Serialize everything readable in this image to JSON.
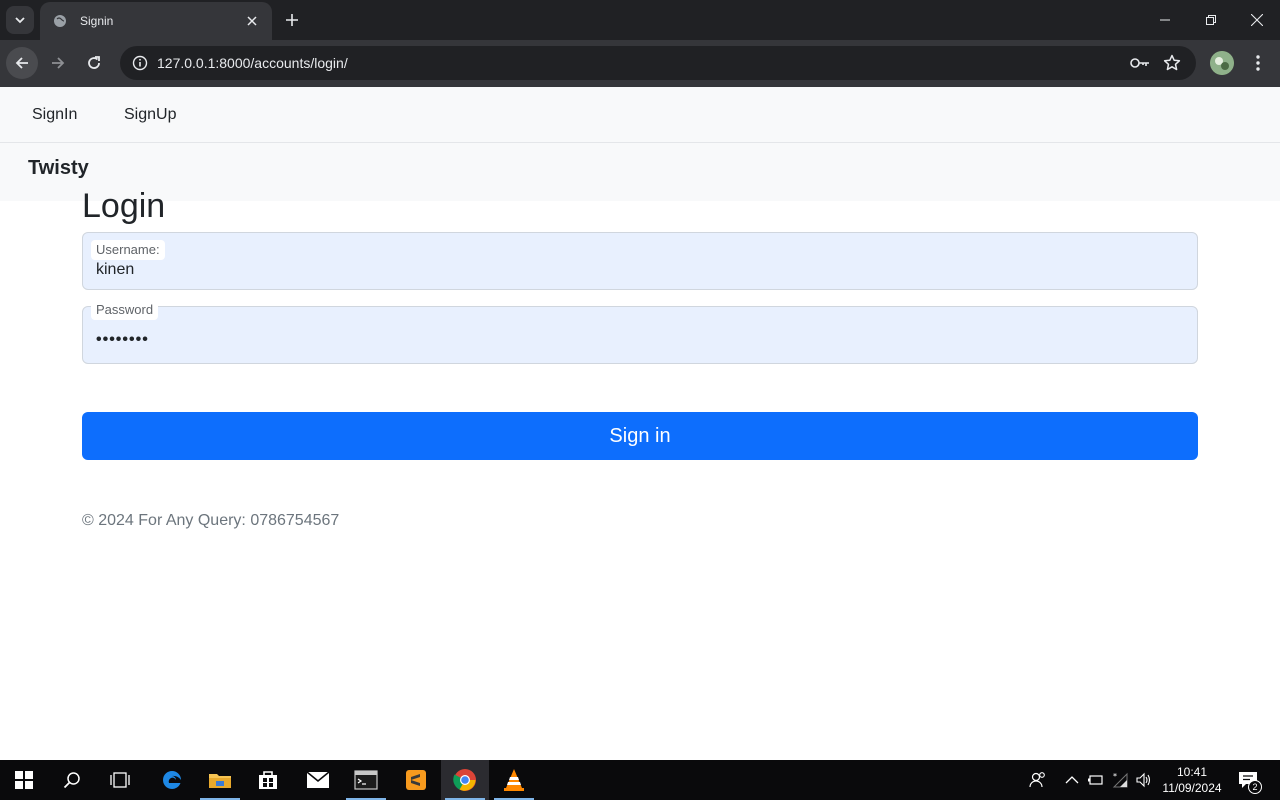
{
  "browser": {
    "tab_title": "Signin",
    "url": "127.0.0.1:8000/accounts/login/"
  },
  "nav": {
    "items": [
      {
        "label": "SignIn"
      },
      {
        "label": "SignUp"
      }
    ],
    "brand": "Twisty"
  },
  "login": {
    "title": "Login",
    "username_label": "Username:",
    "username_value": "kinen",
    "password_label": "Password",
    "password_value": "••••••••",
    "button_label": "Sign in"
  },
  "footer": {
    "text": "© 2024 For Any Query: 0786754567"
  },
  "taskbar": {
    "time": "10:41",
    "date": "11/09/2024",
    "notification_count": "2"
  },
  "colors": {
    "primary": "#0d6efd",
    "nav_bg": "#f8f9fa",
    "field_bg": "#e8f0fe"
  }
}
